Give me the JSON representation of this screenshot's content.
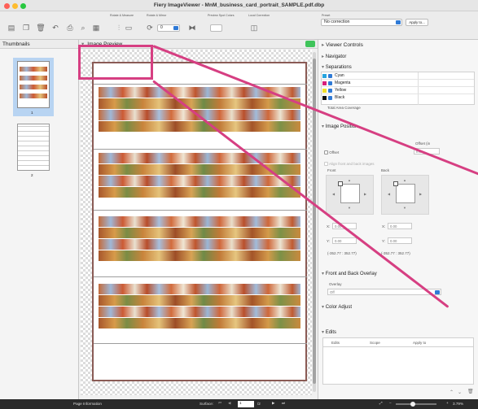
{
  "app": {
    "title": "Fiery ImageViewer - MnM_business_card_portrait_SAMPLE.pdf.dbp"
  },
  "toolbar": {
    "group_labels": [
      "Rotate & Measure",
      "Rotate & Mirror",
      "Preview Spot Colors",
      "Local Correction"
    ],
    "rotate_value": "0",
    "preset_label": "Preset",
    "preset_value": "No correction",
    "apply_button": "Apply to..."
  },
  "thumbnails": {
    "title": "Thumbnails",
    "pages": [
      "1",
      "2"
    ]
  },
  "preview": {
    "title": "Image Preview"
  },
  "viewer_controls": {
    "title": "Viewer Controls",
    "navigator": "Navigator",
    "separations": {
      "title": "Separations",
      "items": [
        {
          "label": "Cyan",
          "color": "#27a4de"
        },
        {
          "label": "Magenta",
          "color": "#d81f7a"
        },
        {
          "label": "Yellow",
          "color": "#f2df2a"
        },
        {
          "label": "Black",
          "color": "#111111"
        }
      ],
      "total_label": "Total Area Coverage"
    },
    "image_position": {
      "title": "Image Position",
      "offset_header": "Offset (in",
      "unit_value": "mm",
      "offset_checkbox": "Offset",
      "align_label": "Align front and back images",
      "front_label": "Front",
      "back_label": "Back",
      "front_x": "0.00",
      "front_y": "0.00",
      "back_x": "0.00",
      "back_y": "0.00",
      "front_coords": "(-352.77 : 352.77)",
      "back_coords": "(-352.77 : 352.77)"
    },
    "overlay": {
      "title": "Front and Back Overlay",
      "label": "Overlay",
      "value": "Off"
    },
    "color_adjust": "Color Adjust",
    "edits": {
      "title": "Edits",
      "columns": [
        "Edits",
        "Scope",
        "Apply to"
      ]
    }
  },
  "statusbar": {
    "page_info": "Page Information",
    "surface_label": "Surface:",
    "page_value": "1",
    "page_total": "/2",
    "zoom_value": "3.79%"
  }
}
